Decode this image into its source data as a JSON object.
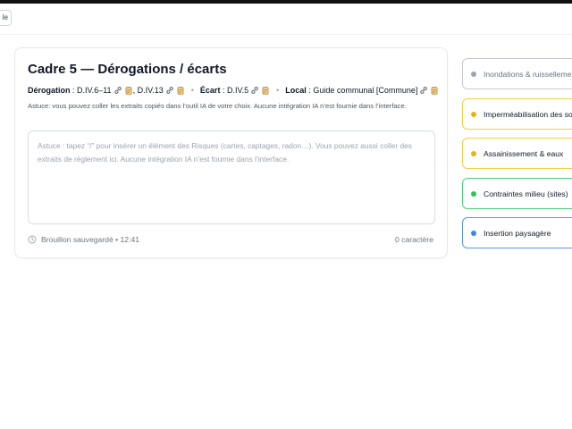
{
  "top": {
    "tab_fragment": "le"
  },
  "card": {
    "title": "Cadre 5 — Dérogations / écarts",
    "refs": {
      "derogation_label": "Dérogation",
      "derogation_value_1": "D.IV.6–11",
      "derogation_value_2": ", D.IV.13",
      "ecart_label": "Écart",
      "ecart_value": "D.IV.5",
      "local_label": "Local",
      "local_value": "Guide communal [Commune]",
      "colon": " : "
    },
    "hint": "Astuce: vous pouvez coller les extraits copiés dans l’outil IA de votre choix. Aucune intégration IA n’est fournie dans l’interface.",
    "editor_placeholder": "Astuce : tapez “/” pour insérer un élément des Risques (cartes, captages, radon…). Vous pouvez aussi coller des extraits de règlement ici. Aucune intégration IA n’est fournie dans l’interface.",
    "status": "Brouillon sauvegardé • 12:41",
    "char_count": "0 caractère"
  },
  "sidebar": {
    "items": [
      {
        "label": "Inondations & ruissellement",
        "dot_color": "#9ca3af",
        "border_color": "#c7cbd1"
      },
      {
        "label": "Imperméabilisation des sols",
        "dot_color": "#eab308",
        "border_color": "#f3cd4a"
      },
      {
        "label": "Assainissement & eaux",
        "dot_color": "#eab308",
        "border_color": "#f3cd4a"
      },
      {
        "label": "Contraintes milieu (sites)",
        "dot_color": "#22c55e",
        "border_color": "#4ccf7a"
      },
      {
        "label": "Insertion paysagère",
        "dot_color": "#3b82f6",
        "border_color": "#5b93e8"
      }
    ]
  },
  "icons": {
    "link": "link-icon",
    "clipboard": "clipboard-icon",
    "clock": "clock-icon"
  }
}
